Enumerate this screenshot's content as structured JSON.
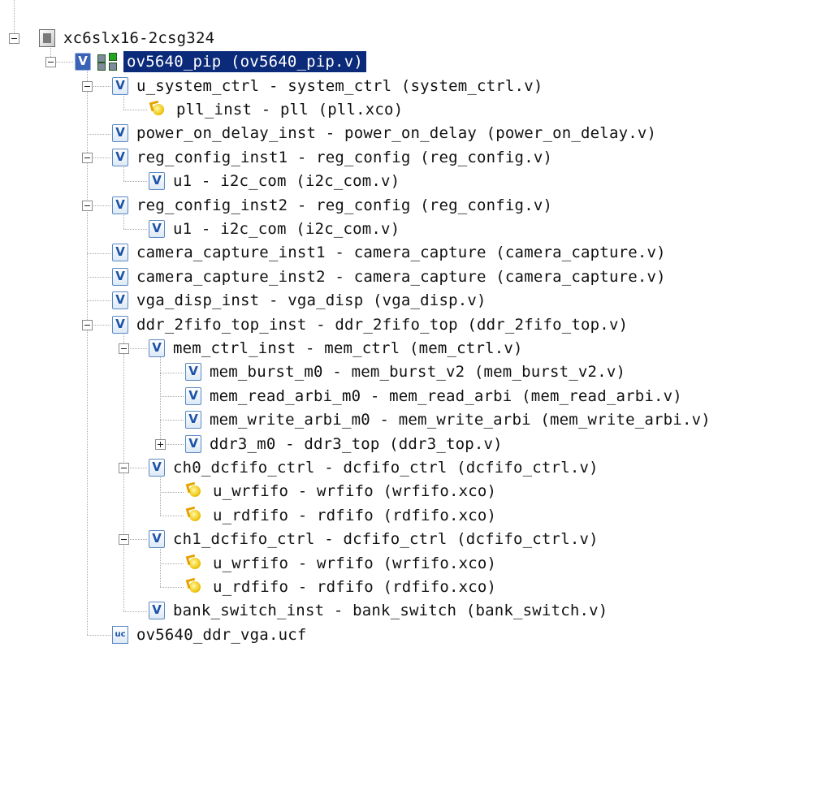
{
  "tree": {
    "rows": [
      {
        "label": "xc6slx16-2csg324",
        "icon": "chip-icon",
        "indent": 0,
        "expander": "minus"
      },
      {
        "label": "ov5640_pip (ov5640_pip.v)",
        "icon": "verilog-top-icon",
        "indent": 1,
        "expander": "minus",
        "selected": true
      },
      {
        "label": "u_system_ctrl - system_ctrl (system_ctrl.v)",
        "icon": "verilog-icon",
        "indent": 2,
        "expander": "minus"
      },
      {
        "label": "pll_inst - pll (pll.xco)",
        "icon": "ip-core-icon",
        "indent": 3,
        "expander": null
      },
      {
        "label": "power_on_delay_inst - power_on_delay (power_on_delay.v)",
        "icon": "verilog-icon",
        "indent": 2,
        "expander": null
      },
      {
        "label": "reg_config_inst1 - reg_config (reg_config.v)",
        "icon": "verilog-icon",
        "indent": 2,
        "expander": "minus"
      },
      {
        "label": "u1 - i2c_com (i2c_com.v)",
        "icon": "verilog-icon",
        "indent": 3,
        "expander": null
      },
      {
        "label": "reg_config_inst2 - reg_config (reg_config.v)",
        "icon": "verilog-icon",
        "indent": 2,
        "expander": "minus"
      },
      {
        "label": "u1 - i2c_com (i2c_com.v)",
        "icon": "verilog-icon",
        "indent": 3,
        "expander": null
      },
      {
        "label": "camera_capture_inst1 - camera_capture (camera_capture.v)",
        "icon": "verilog-icon",
        "indent": 2,
        "expander": null
      },
      {
        "label": "camera_capture_inst2 - camera_capture (camera_capture.v)",
        "icon": "verilog-icon",
        "indent": 2,
        "expander": null
      },
      {
        "label": "vga_disp_inst - vga_disp (vga_disp.v)",
        "icon": "verilog-icon",
        "indent": 2,
        "expander": null
      },
      {
        "label": "ddr_2fifo_top_inst - ddr_2fifo_top (ddr_2fifo_top.v)",
        "icon": "verilog-icon",
        "indent": 2,
        "expander": "minus"
      },
      {
        "label": "mem_ctrl_inst - mem_ctrl (mem_ctrl.v)",
        "icon": "verilog-icon",
        "indent": 3,
        "expander": "minus"
      },
      {
        "label": "mem_burst_m0 - mem_burst_v2 (mem_burst_v2.v)",
        "icon": "verilog-icon",
        "indent": 4,
        "expander": null
      },
      {
        "label": "mem_read_arbi_m0 - mem_read_arbi (mem_read_arbi.v)",
        "icon": "verilog-icon",
        "indent": 4,
        "expander": null
      },
      {
        "label": "mem_write_arbi_m0 - mem_write_arbi (mem_write_arbi.v)",
        "icon": "verilog-icon",
        "indent": 4,
        "expander": null
      },
      {
        "label": "ddr3_m0 - ddr3_top (ddr3_top.v)",
        "icon": "verilog-icon",
        "indent": 4,
        "expander": "plus"
      },
      {
        "label": "ch0_dcfifo_ctrl - dcfifo_ctrl (dcfifo_ctrl.v)",
        "icon": "verilog-icon",
        "indent": 3,
        "expander": "minus"
      },
      {
        "label": "u_wrfifo - wrfifo (wrfifo.xco)",
        "icon": "ip-core-icon",
        "indent": 4,
        "expander": null
      },
      {
        "label": "u_rdfifo - rdfifo (rdfifo.xco)",
        "icon": "ip-core-icon",
        "indent": 4,
        "expander": null
      },
      {
        "label": "ch1_dcfifo_ctrl - dcfifo_ctrl (dcfifo_ctrl.v)",
        "icon": "verilog-icon",
        "indent": 3,
        "expander": "minus"
      },
      {
        "label": "u_wrfifo - wrfifo (wrfifo.xco)",
        "icon": "ip-core-icon",
        "indent": 4,
        "expander": null
      },
      {
        "label": "u_rdfifo - rdfifo (rdfifo.xco)",
        "icon": "ip-core-icon",
        "indent": 4,
        "expander": null
      },
      {
        "label": "bank_switch_inst - bank_switch (bank_switch.v)",
        "icon": "verilog-icon",
        "indent": 3,
        "expander": null
      },
      {
        "label": "ov5640_ddr_vga.ucf",
        "icon": "ucf-file-icon",
        "indent": 2,
        "expander": null
      }
    ]
  },
  "colors": {
    "selection": "#0b2a7a",
    "tree_line": "#a8a8a8"
  }
}
